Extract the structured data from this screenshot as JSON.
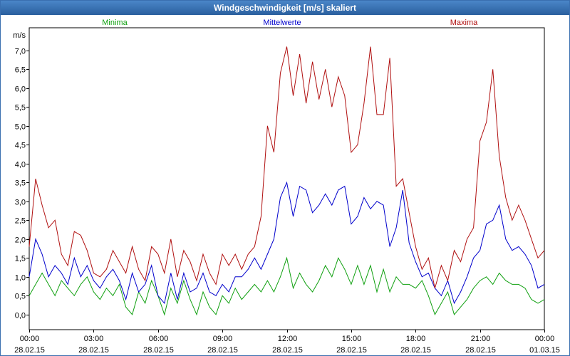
{
  "window": {
    "title": "Windgeschwindigkeit [m/s] skaliert"
  },
  "colors": {
    "minima": "#10a010",
    "mittelwerte": "#0000cc",
    "maxima": "#b01010",
    "grid": "#000000",
    "title_bg": "#2f6bb0"
  },
  "chart_data": {
    "type": "line",
    "title": "Windgeschwindigkeit [m/s] skaliert",
    "ylabel": "m/s",
    "xlabel": "",
    "ylim": [
      -0.4,
      7.6
    ],
    "yticks": [
      "0,0",
      "0,5",
      "1,0",
      "1,5",
      "2,0",
      "2,5",
      "3,0",
      "3,5",
      "4,0",
      "4,5",
      "5,0",
      "5,5",
      "6,0",
      "6,5",
      "7,0"
    ],
    "xlim": [
      0,
      24
    ],
    "xticks": [
      {
        "time": "00:00",
        "date": "28.02.15"
      },
      {
        "time": "03:00",
        "date": "28.02.15"
      },
      {
        "time": "06:00",
        "date": "28.02.15"
      },
      {
        "time": "09:00",
        "date": "28.02.15"
      },
      {
        "time": "12:00",
        "date": "28.02.15"
      },
      {
        "time": "15:00",
        "date": "28.02.15"
      },
      {
        "time": "18:00",
        "date": "28.02.15"
      },
      {
        "time": "21:00",
        "date": "28.02.15"
      },
      {
        "time": "00:00",
        "date": "01.03.15"
      }
    ],
    "grid": true,
    "x_hours": [
      0.0,
      0.3,
      0.6,
      0.9,
      1.2,
      1.5,
      1.8,
      2.1,
      2.4,
      2.7,
      3.0,
      3.3,
      3.6,
      3.9,
      4.2,
      4.5,
      4.8,
      5.1,
      5.4,
      5.7,
      6.0,
      6.3,
      6.6,
      6.9,
      7.2,
      7.5,
      7.8,
      8.1,
      8.4,
      8.7,
      9.0,
      9.3,
      9.6,
      9.9,
      10.2,
      10.5,
      10.8,
      11.1,
      11.4,
      11.7,
      12.0,
      12.3,
      12.6,
      12.9,
      13.2,
      13.5,
      13.8,
      14.1,
      14.4,
      14.7,
      15.0,
      15.3,
      15.6,
      15.9,
      16.2,
      16.5,
      16.8,
      17.1,
      17.4,
      17.7,
      18.0,
      18.3,
      18.6,
      18.9,
      19.2,
      19.5,
      19.8,
      20.1,
      20.4,
      20.7,
      21.0,
      21.3,
      21.6,
      21.9,
      22.2,
      22.5,
      22.8,
      23.1,
      23.4,
      23.7,
      24.0
    ],
    "series": [
      {
        "name": "Minima",
        "color_key": "minima",
        "values": [
          0.5,
          0.8,
          1.1,
          0.8,
          0.5,
          0.9,
          0.7,
          0.5,
          0.8,
          1.0,
          0.6,
          0.4,
          0.7,
          0.5,
          0.8,
          0.2,
          0.0,
          0.6,
          0.3,
          0.9,
          0.5,
          0.0,
          0.7,
          0.3,
          0.9,
          0.4,
          0.0,
          0.6,
          0.2,
          0.0,
          0.5,
          0.3,
          0.7,
          0.4,
          0.6,
          0.8,
          0.6,
          0.9,
          0.6,
          1.0,
          1.5,
          0.7,
          1.1,
          0.8,
          0.6,
          0.9,
          1.3,
          1.0,
          1.5,
          1.2,
          0.8,
          1.3,
          0.8,
          1.3,
          0.6,
          1.2,
          0.6,
          1.0,
          0.8,
          0.8,
          0.7,
          0.9,
          0.5,
          0.0,
          0.3,
          0.6,
          0.0,
          0.2,
          0.4,
          0.7,
          0.9,
          1.0,
          0.8,
          1.1,
          0.9,
          0.8,
          0.8,
          0.7,
          0.4,
          0.3,
          0.4
        ]
      },
      {
        "name": "Mittelwerte",
        "color_key": "mittelwerte",
        "values": [
          1.0,
          2.0,
          1.6,
          1.0,
          1.3,
          1.1,
          0.8,
          1.5,
          1.0,
          1.3,
          0.9,
          0.7,
          1.0,
          1.2,
          0.9,
          0.4,
          1.1,
          0.6,
          0.8,
          1.3,
          0.5,
          0.3,
          1.1,
          0.4,
          1.1,
          0.6,
          0.7,
          1.1,
          0.6,
          0.5,
          0.8,
          0.6,
          1.0,
          1.0,
          1.2,
          1.5,
          1.2,
          1.6,
          2.0,
          3.1,
          3.5,
          2.6,
          3.4,
          3.3,
          2.7,
          2.9,
          3.2,
          2.9,
          3.3,
          3.4,
          2.4,
          2.6,
          3.1,
          2.8,
          3.0,
          2.9,
          1.8,
          2.3,
          3.3,
          1.9,
          1.4,
          1.0,
          1.1,
          0.7,
          0.5,
          0.9,
          0.3,
          0.6,
          1.0,
          1.5,
          1.7,
          2.4,
          2.5,
          2.9,
          2.0,
          1.7,
          1.8,
          1.6,
          1.3,
          0.7,
          0.8
        ]
      },
      {
        "name": "Maxima",
        "color_key": "maxima",
        "values": [
          1.8,
          3.6,
          2.9,
          2.3,
          2.5,
          1.6,
          1.3,
          2.2,
          2.1,
          1.7,
          1.1,
          1.0,
          1.2,
          1.7,
          1.4,
          1.1,
          1.8,
          1.2,
          0.9,
          1.8,
          1.6,
          1.1,
          2.0,
          1.0,
          1.7,
          1.4,
          0.9,
          1.6,
          1.1,
          0.8,
          1.6,
          1.3,
          1.6,
          1.2,
          1.6,
          1.8,
          2.6,
          5.0,
          4.3,
          6.4,
          7.1,
          5.8,
          6.9,
          5.6,
          6.7,
          5.7,
          6.5,
          5.5,
          6.3,
          5.8,
          4.3,
          4.5,
          5.6,
          7.1,
          5.3,
          5.3,
          6.8,
          3.4,
          3.6,
          2.7,
          1.8,
          1.2,
          1.5,
          0.7,
          1.3,
          0.9,
          1.7,
          1.4,
          2.0,
          2.3,
          4.6,
          5.1,
          6.5,
          4.2,
          3.1,
          2.5,
          2.9,
          2.5,
          2.0,
          1.5,
          1.7
        ]
      }
    ]
  }
}
